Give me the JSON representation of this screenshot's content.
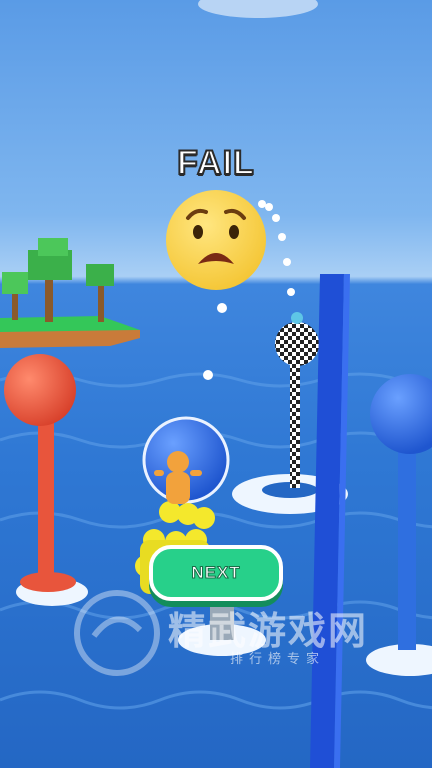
{
  "screen": {
    "status_text": "FAIL",
    "result_emoji": "worried-face-icon",
    "next_button_label": "NEXT"
  },
  "watermark": {
    "title": "精武游戏网",
    "subtitle": "排行榜专家"
  },
  "colors": {
    "water": "#2f78d4",
    "next_button": "#27d08a",
    "red_pole": "#e8553c",
    "blue_ball": "#2f6fe0",
    "player": "#f2a23c",
    "crowd": "#f4e82c",
    "blue_wall": "#1f4fd6"
  }
}
